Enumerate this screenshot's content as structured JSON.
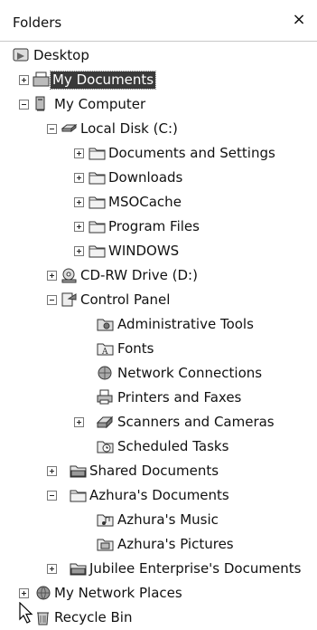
{
  "header": {
    "title": "Folders",
    "close_label": "×"
  },
  "tree": {
    "desktop": "Desktop",
    "my_documents": "My Documents",
    "my_computer": "My Computer",
    "local_disk": "Local Disk (C:)",
    "documents_and_settings": "Documents and Settings",
    "downloads": "Downloads",
    "msocache": "MSOCache",
    "program_files": "Program Files",
    "windows": "WINDOWS",
    "cdrw_drive": "CD-RW Drive (D:)",
    "control_panel": "Control Panel",
    "administrative_tools": "Administrative Tools",
    "fonts": "Fonts",
    "network_connections": "Network Connections",
    "printers_and_faxes": "Printers and Faxes",
    "scanners_and_cameras": "Scanners and Cameras",
    "scheduled_tasks": "Scheduled Tasks",
    "shared_documents": "Shared Documents",
    "azhuras_documents": "Azhura's Documents",
    "azhuras_music": "Azhura's Music",
    "azhuras_pictures": "Azhura's Pictures",
    "jubilee_documents": "Jubilee Enterprise's Documents",
    "my_network_places": "My Network Places",
    "recycle_bin": "Recycle Bin"
  },
  "icons": {
    "desktop": "desktop-icon",
    "my_documents": "my-documents-icon",
    "my_computer": "computer-icon",
    "local_disk": "hard-drive-icon",
    "folder": "folder-icon",
    "cd_drive": "cd-drive-icon",
    "control_panel": "control-panel-icon",
    "administrative_tools": "administrative-tools-icon",
    "fonts": "fonts-folder-icon",
    "network_connections": "network-connections-icon",
    "printers": "printer-icon",
    "scanners": "scanner-icon",
    "scheduled_tasks": "scheduled-tasks-icon",
    "music": "music-folder-icon",
    "pictures": "pictures-folder-icon",
    "network_places": "network-places-icon",
    "recycle_bin": "recycle-bin-icon"
  },
  "selected": "My Documents"
}
